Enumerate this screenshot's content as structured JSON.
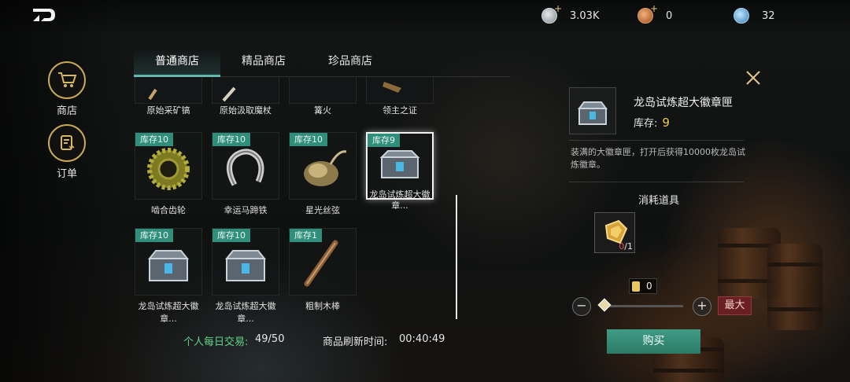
{
  "currencies": [
    {
      "icon": "silver-coin-icon",
      "value": "3.03K",
      "has_plus": true
    },
    {
      "icon": "copper-coin-icon",
      "value": "0",
      "has_plus": true
    },
    {
      "icon": "crystal-orb-icon",
      "value": "32",
      "has_plus": false
    }
  ],
  "nav": [
    {
      "icon": "shopping-cart-icon",
      "label": "商店"
    },
    {
      "icon": "order-list-icon",
      "label": "订单"
    }
  ],
  "tabs": [
    "普通商店",
    "精品商店",
    "珍品商店"
  ],
  "active_tab": "普通商店",
  "partial_row": [
    {
      "name": "原始采矿镐"
    },
    {
      "name": "原始汲取魔杖"
    },
    {
      "name": "篝火"
    },
    {
      "name": "领主之证"
    }
  ],
  "items": [
    {
      "stock": "库存10",
      "name": "啮合齿轮",
      "icon": "gear-icon"
    },
    {
      "stock": "库存10",
      "name": "幸运马蹄铁",
      "icon": "horseshoe-icon"
    },
    {
      "stock": "库存10",
      "name": "星光丝弦",
      "icon": "starlight-string-icon"
    },
    {
      "stock": "库存9",
      "name": "龙岛试炼超大徽章...",
      "icon": "badge-chest-icon",
      "selected": true
    },
    {
      "stock": "库存10",
      "name": "龙岛试炼超大徽章...",
      "icon": "badge-chest-icon"
    },
    {
      "stock": "库存10",
      "name": "龙岛试炼超大徽章...",
      "icon": "badge-chest-icon"
    },
    {
      "stock": "库存1",
      "name": "粗制木棒",
      "icon": "wooden-club-icon"
    }
  ],
  "footer": {
    "daily_trade_label": "个人每日交易:",
    "daily_trade_value": "49/50",
    "refresh_label": "商品刷新时间:",
    "refresh_value": "00:40:49"
  },
  "detail": {
    "name": "龙岛试炼超大徽章匣",
    "stock_label": "库存:",
    "stock_value": "9",
    "description": "装满的大徽章匣，打开后获得10000枚龙岛试炼徽章。",
    "consume_title": "消耗道具",
    "consume_have": "0",
    "consume_need": "/1",
    "quantity": "0",
    "max_label": "最大",
    "buy_label": "购买"
  },
  "colors": {
    "accent_teal": "#2f8f7b",
    "stock_gold": "#f2c94c",
    "buy_green": "#3f9c86",
    "max_red": "#6a1f22",
    "trade_label_green": "#5fd38a"
  }
}
